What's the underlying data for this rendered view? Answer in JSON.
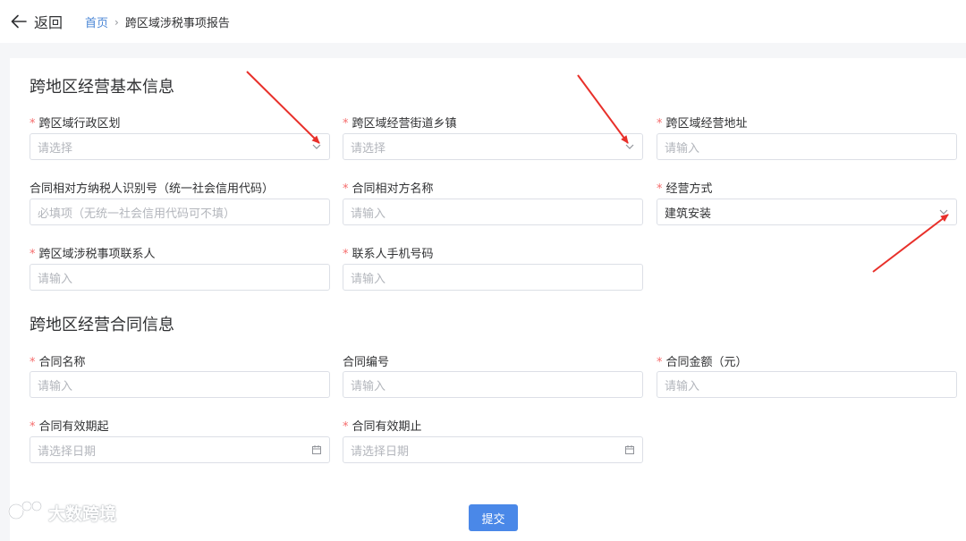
{
  "header": {
    "back_label": "返回",
    "breadcrumb": {
      "home": "首页",
      "separator": "›",
      "current": "跨区域涉税事项报告"
    }
  },
  "sections": {
    "basic": {
      "title": "跨地区经营基本信息"
    },
    "contract": {
      "title": "跨地区经营合同信息"
    }
  },
  "fields": {
    "region": {
      "label": "跨区域行政区划",
      "required": true,
      "placeholder": "请选择",
      "icon": "chevron-down-icon"
    },
    "street": {
      "label": "跨区域经营街道乡镇",
      "required": true,
      "placeholder": "请选择",
      "icon": "chevron-down-icon"
    },
    "address": {
      "label": "跨区域经营地址",
      "required": true,
      "placeholder": "请输入"
    },
    "taxpayer_id": {
      "label": "合同相对方纳税人识别号（统一社会信用代码）",
      "required": false,
      "placeholder": "必填项（无统一社会信用代码可不填）"
    },
    "counterparty": {
      "label": "合同相对方名称",
      "required": true,
      "placeholder": "请输入"
    },
    "business_mode": {
      "label": "经营方式",
      "required": true,
      "value": "建筑安装",
      "icon": "chevron-down-icon"
    },
    "contact": {
      "label": "跨区域涉税事项联系人",
      "required": true,
      "placeholder": "请输入"
    },
    "phone": {
      "label": "联系人手机号码",
      "required": true,
      "placeholder": "请输入"
    },
    "contract_name": {
      "label": "合同名称",
      "required": true,
      "placeholder": "请输入"
    },
    "contract_no": {
      "label": "合同编号",
      "required": false,
      "placeholder": "请输入"
    },
    "contract_amount": {
      "label": "合同金额（元）",
      "required": true,
      "placeholder": "请输入"
    },
    "valid_from": {
      "label": "合同有效期起",
      "required": true,
      "placeholder": "请选择日期",
      "icon": "calendar-icon"
    },
    "valid_to": {
      "label": "合同有效期止",
      "required": true,
      "placeholder": "请选择日期",
      "icon": "calendar-icon"
    }
  },
  "required_mark": "*",
  "submit_label": "提交",
  "watermark": {
    "text": "大数跨境",
    "icon": "logo-icon"
  },
  "colors": {
    "accent": "#4a88e8",
    "link": "#4b87d6",
    "required": "#f56c6c",
    "annotation_arrow": "#e8302a"
  }
}
